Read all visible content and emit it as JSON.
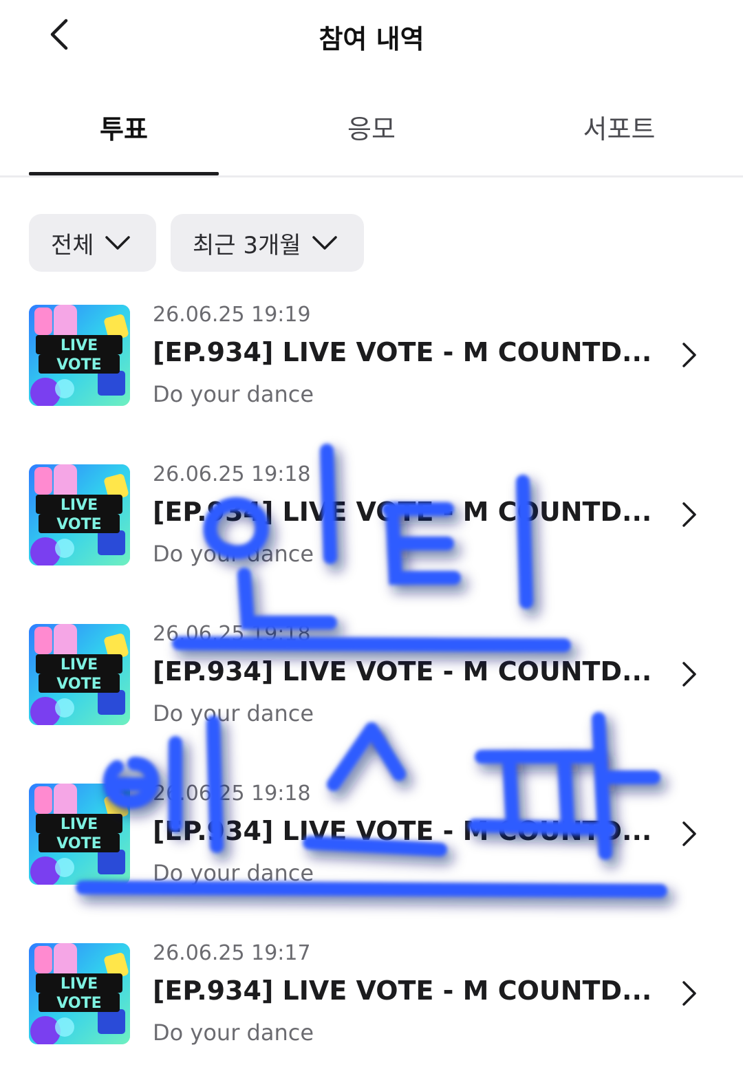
{
  "header": {
    "title": "참여 내역",
    "back_icon": "chevron-left-icon"
  },
  "tabs": [
    {
      "label": "투표",
      "active": true
    },
    {
      "label": "응모",
      "active": false
    },
    {
      "label": "서포트",
      "active": false
    }
  ],
  "filters": [
    {
      "label": "전체",
      "icon": "chevron-down-icon"
    },
    {
      "label": "최근 3개월",
      "icon": "chevron-down-icon"
    }
  ],
  "thumbnail_text": {
    "line1": "LIVE",
    "line2": "VOTE"
  },
  "items": [
    {
      "date": "26.06.25 19:19",
      "title": "[EP.934] LIVE VOTE - M COUNTD...",
      "subtitle": "Do your dance"
    },
    {
      "date": "26.06.25 19:18",
      "title": "[EP.934] LIVE VOTE - M COUNTD...",
      "subtitle": "Do your dance"
    },
    {
      "date": "26.06.25 19:18",
      "title": "[EP.934] LIVE VOTE - M COUNTD...",
      "subtitle": "Do your dance"
    },
    {
      "date": "26.06.25 19:18",
      "title": "[EP.934] LIVE VOTE - M COUNTD...",
      "subtitle": "Do your dance"
    },
    {
      "date": "26.06.25 19:17",
      "title": "[EP.934] LIVE VOTE - M COUNTD...",
      "subtitle": "Do your dance"
    }
  ],
  "overlay_text": {
    "line1": "인티",
    "line2": "에스파",
    "color": "#2f5bff"
  },
  "colors": {
    "active_tab": "#1c1c1e",
    "filter_bg": "#eeeef1",
    "overlay": "#2f5bff"
  }
}
